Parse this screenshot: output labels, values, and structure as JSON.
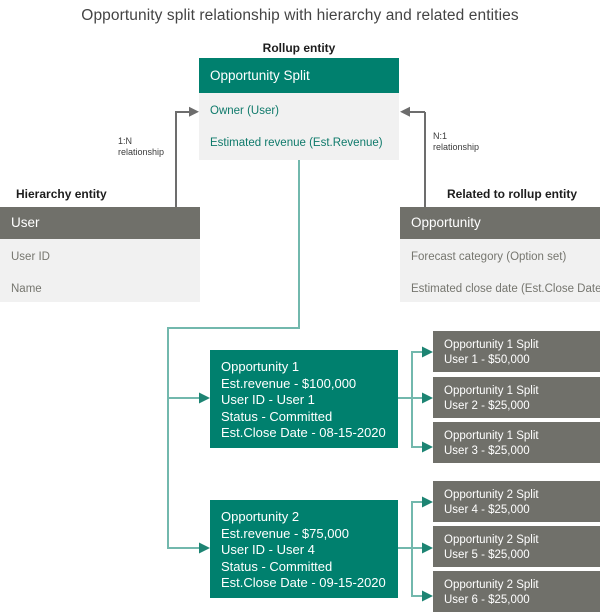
{
  "title": "Opportunity split relationship with hierarchy and related entities",
  "colors": {
    "teal": "#00806e",
    "gray": "#70706a",
    "panel": "#f1f1f1",
    "teal_connector": "#72b8ad",
    "gray_connector": "#6d6d6d",
    "teal_text": "#0f7a6b",
    "gray_text": "#76766f"
  },
  "captions": {
    "rollup": "Rollup entity",
    "hierarchy": "Hierarchy entity",
    "related": "Related to rollup entity"
  },
  "relationships": {
    "left": {
      "cardinality": "1:N",
      "word": "relationship"
    },
    "right": {
      "cardinality": "N:1",
      "word": "relationship"
    }
  },
  "entities": {
    "rollup": {
      "name": "Opportunity Split",
      "fields": [
        "Owner (User)",
        "Estimated revenue (Est.Revenue)"
      ]
    },
    "hierarchy": {
      "name": "User",
      "fields": [
        "User ID",
        "Name"
      ]
    },
    "related": {
      "name": "Opportunity",
      "fields": [
        "Forecast category (Option set)",
        "Estimated close date (Est.Close Date)"
      ]
    }
  },
  "opportunities": [
    {
      "lines": [
        "Opportunity 1",
        "Est.revenue - $100,000",
        "User ID - User 1",
        "Status - Committed",
        "Est.Close Date - 08-15-2020"
      ],
      "splits": [
        {
          "title": "Opportunity 1 Split",
          "detail": "User 1 - $50,000"
        },
        {
          "title": "Opportunity 1 Split",
          "detail": "User 2 - $25,000"
        },
        {
          "title": "Opportunity 1 Split",
          "detail": "User 3 - $25,000"
        }
      ]
    },
    {
      "lines": [
        "Opportunity 2",
        "Est.revenue - $75,000",
        "User ID - User 4",
        "Status - Committed",
        "Est.Close Date - 09-15-2020"
      ],
      "splits": [
        {
          "title": "Opportunity 2 Split",
          "detail": "User 4 - $25,000"
        },
        {
          "title": "Opportunity 2 Split",
          "detail": "User 5 - $25,000"
        },
        {
          "title": "Opportunity 2 Split",
          "detail": "User 6 - $25,000"
        }
      ]
    }
  ]
}
